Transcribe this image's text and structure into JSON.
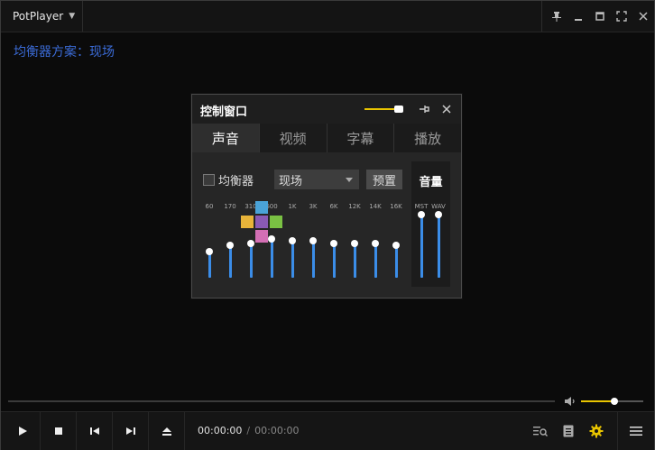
{
  "app": {
    "name": "PotPlayer"
  },
  "equalizer_title": "均衡器方案：现场",
  "panel": {
    "title": "控制窗口",
    "tabs": [
      {
        "label": "声音",
        "active": true
      },
      {
        "label": "视频",
        "active": false
      },
      {
        "label": "字幕",
        "active": false
      },
      {
        "label": "播放",
        "active": false
      }
    ],
    "eq_toggle_label": "均衡器",
    "preset_value": "现场",
    "preset_button": "预置",
    "volume_label": "音量",
    "opacity_level": 0.85,
    "bands": [
      {
        "label": "60",
        "level": 0.58
      },
      {
        "label": "170",
        "level": 0.48
      },
      {
        "label": "310",
        "level": 0.45
      },
      {
        "label": "600",
        "level": 0.38
      },
      {
        "label": "1K",
        "level": 0.42
      },
      {
        "label": "3K",
        "level": 0.42
      },
      {
        "label": "6K",
        "level": 0.45
      },
      {
        "label": "12K",
        "level": 0.45
      },
      {
        "label": "14K",
        "level": 0.45
      },
      {
        "label": "16K",
        "level": 0.48
      }
    ],
    "volume_bands": [
      {
        "label": "MST",
        "level": 0.0
      },
      {
        "label": "WAV",
        "level": 0.0
      }
    ]
  },
  "playback": {
    "current_time": "00:00:00",
    "separator": "/",
    "duration": "00:00:00",
    "volume_level": 0.5
  },
  "colors": {
    "accent": "#e8c400",
    "eq_slider": "#3b8de8",
    "title_text": "#3b6bd6"
  }
}
